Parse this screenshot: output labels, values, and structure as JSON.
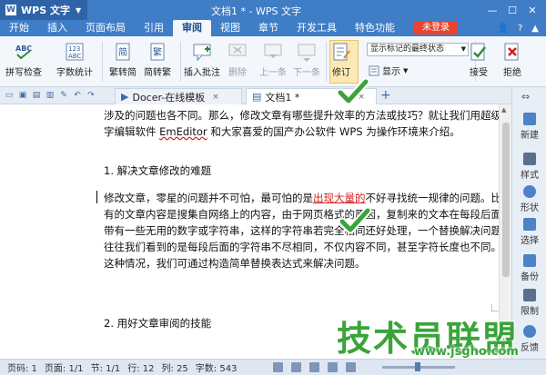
{
  "app": {
    "name": "WPS 文字",
    "window_title": "文档1 * - WPS 文字"
  },
  "menu": {
    "items": [
      "开始",
      "插入",
      "页面布局",
      "引用",
      "审阅",
      "视图",
      "章节",
      "开发工具",
      "特色功能"
    ],
    "active": "审阅",
    "login": "未登录"
  },
  "ribbon": {
    "spell_check": "拼写检查",
    "word_count": "字数统计",
    "trad_to_simp": "繁转简",
    "simp_to_trad": "简转繁",
    "insert_comment": "插入批注",
    "delete": "删除",
    "prev": "上一条",
    "next": "下一条",
    "revise": "修订",
    "markup_select": "显示标记的最终状态",
    "show": "显示",
    "accept": "接受",
    "reject": "拒绝"
  },
  "tabs": {
    "docer": "Docer-在线模板",
    "doc1": "文档1 *"
  },
  "document": {
    "line1": "涉及的问题也各不同。那么，修改文章有哪些提升效率的方法或技巧？就让我们用超级文",
    "line2_a": "字编辑软件 ",
    "line2_b": "EmEditor",
    "line2_c": " 和大家喜爱的国产办公软件 WPS 为操作环境来介绍。",
    "heading1": "1. 解决文章修改的难题",
    "p1_a": "修改文章，零星的问题并不可怕，最可怕的是",
    "p1_b": "出现大量的",
    "p1_c": "不好寻找统一规律的问题。比如说",
    "p2": "有的文章内容是搜集自网络上的内容，由于网页格式的原因，复制来的文本在每段后面可",
    "p3": "带有一些无用的数字或字符串，这样的字符串若完全相同还好处理，一个替换解决问题。",
    "p4": "往往我们看到的是每段后面的字符串不尽相同，不仅内容不同，甚至字符长度也不同。遇",
    "p5": "这种情况，我们可通过构造简单替换表达式来解决问题。",
    "heading2": "2. 用好文章审阅的技能"
  },
  "right_pane": [
    "新建",
    "样式",
    "形状",
    "选择",
    "备份",
    "限制",
    "反馈"
  ],
  "status": {
    "page": "页码: 1",
    "pages": "页面: 1/1",
    "section": "节: 1/1",
    "row": "行: 12",
    "col": "列: 25",
    "chars": "字数: 543"
  },
  "watermark": {
    "logo": "技术员联盟",
    "url": "www.jsgho.com"
  },
  "colors": {
    "title_bar": "#3f7dc6",
    "ribbon_bg": "#f3f6fa",
    "login_red": "#e8442e",
    "revision_red": "#d21f1f",
    "watermark_green": "#3aa43a"
  }
}
